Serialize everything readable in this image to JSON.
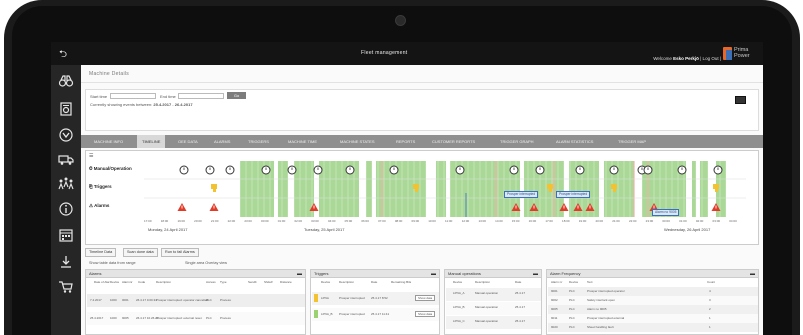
{
  "app": {
    "title": "Fleet management",
    "welcome_prefix": "Welcome ",
    "user_name": "Esko Perkjö",
    "logout_text": " | Log Out |",
    "logo_line1": "Prima",
    "logo_line2": "Power"
  },
  "page": {
    "title": "Machine Details",
    "start_label": "Start time",
    "end_label": "End time",
    "go_label": "Go",
    "range_text": "Currently showing events between:",
    "range_start": "25.4.2017",
    "range_dash": " - ",
    "range_end": "26.4.2017"
  },
  "tabs": [
    {
      "label": "MACHINE INFO"
    },
    {
      "label": "TIMELINE"
    },
    {
      "label": "OEE DATA"
    },
    {
      "label": "ALARMS"
    },
    {
      "label": "TRIGGERS"
    },
    {
      "label": "MACHINE TIME"
    },
    {
      "label": "MACHINE STATES"
    },
    {
      "label": "REPORTS"
    },
    {
      "label": "CUSTOMER REPORTS"
    },
    {
      "label": "TRIGGER GRAPH"
    },
    {
      "label": "ALARM STATISTICS"
    },
    {
      "label": "TRIGGER MAP"
    }
  ],
  "timeline": {
    "rows": [
      {
        "label": "Manual/Operation"
      },
      {
        "label": "Triggers"
      },
      {
        "label": "Alarms"
      }
    ],
    "tick_labels": [
      "17:00",
      "18:00",
      "19:00",
      "20:00",
      "21:00",
      "22:00",
      "23:00",
      "00:00",
      "01:00",
      "02:00",
      "03:00",
      "04:00",
      "05:00",
      "06:00",
      "07:00",
      "08:00",
      "09:00",
      "10:00",
      "11:00",
      "12:00",
      "13:00",
      "14:00",
      "15:00",
      "16:00",
      "17:00",
      "18:00",
      "19:00",
      "20:00",
      "21:00",
      "22:00",
      "23:00",
      "00:00",
      "01:00",
      "02:00",
      "03:00",
      "04:00"
    ],
    "date_labels": [
      "Monday, 24 April 2017",
      "Tuesday, 25 April 2017",
      "Wednesday, 26 April 2017"
    ],
    "tooltips": [
      "Prosper interrupted",
      "Prosper interrupted",
      "Alarm no 9005"
    ]
  },
  "subtabs": [
    {
      "label": "Timeline Data"
    },
    {
      "label": "Scan done data"
    },
    {
      "label": "Run to fail Alarms"
    }
  ],
  "filters": {
    "show_text": "Show table data from range",
    "radio_text": "Single area  Overlay view"
  },
  "panels": {
    "alarms": {
      "title": "Alarms",
      "columns": [
        "Date of Alar",
        "Device",
        "Alarmnr",
        "Code",
        "Description",
        "Access",
        "Type",
        "Sendlt",
        "Shdelf",
        "Distance"
      ],
      "rows": [
        {
          "date": "7.4.2017",
          "device": "1000",
          "alarm": "0001",
          "code": "26.4.17 0.00.34",
          "desc": "Prosper interrupted: operator cancelled",
          "access": "PLC",
          "type": "Process"
        },
        {
          "date": "25.4.2017",
          "device": "1000",
          "alarm": "9005",
          "code": "26.4.17 10.26.23",
          "desc": "Prosper interrupted: external reset",
          "access": "PLC",
          "type": "Process"
        }
      ]
    },
    "triggers": {
      "title": "Triggers",
      "columns": [
        "Device",
        "Description",
        "Date",
        "Remaining Bits"
      ],
      "rows": [
        {
          "device": "LPNA",
          "desc": "Prosper interrupted",
          "date": "25.4.17 8:52",
          "button": "Show data"
        },
        {
          "device": "LPNA_B",
          "desc": "Prosper interrupted",
          "date": "25.4.17 11:41",
          "button": "Show data"
        }
      ]
    },
    "manual": {
      "title": "Manual operations",
      "columns": [
        "Device",
        "Description",
        "Date"
      ],
      "rows": [
        {
          "device": "LPNA_A",
          "desc": "Manual operation",
          "date": "25.4.17"
        },
        {
          "device": "LPNA_B",
          "desc": "Manual operation",
          "date": "25.4.17"
        },
        {
          "device": "LPNA_C",
          "desc": "Manual operation",
          "date": "25.4.17"
        }
      ]
    },
    "frequency": {
      "title": "Alarm Frequency",
      "columns": [
        "Alarm nr",
        "Device",
        "Text",
        "Count"
      ],
      "rows": [
        {
          "nr": "9001",
          "device": "PLC",
          "text": "Prosper interrupted operator",
          "count": "4"
        },
        {
          "nr": "9002",
          "device": "PLC",
          "text": "Safety interlock open",
          "count": "3"
        },
        {
          "nr": "9005",
          "device": "PLC",
          "text": "Alarm no 9005",
          "count": "2"
        },
        {
          "nr": "9011",
          "device": "PLC",
          "text": "Prosper interrupted external",
          "count": "1"
        },
        {
          "nr": "9020",
          "device": "PLC",
          "text": "Sheet handling fault",
          "count": "1"
        }
      ]
    }
  },
  "colors": {
    "accent_orange": "#e8682a",
    "accent_blue": "#3b6fb6",
    "timeline_green": "#a9d897",
    "alarm_red": "#e23b2a",
    "trigger_yellow": "#f2c230"
  },
  "icons": {
    "sidebar": [
      "back-icon",
      "binoculars-icon",
      "machine-icon",
      "settings-circle-icon",
      "truck-icon",
      "network-icon",
      "info-icon",
      "calendar-icon",
      "download-icon",
      "cart-icon"
    ]
  }
}
